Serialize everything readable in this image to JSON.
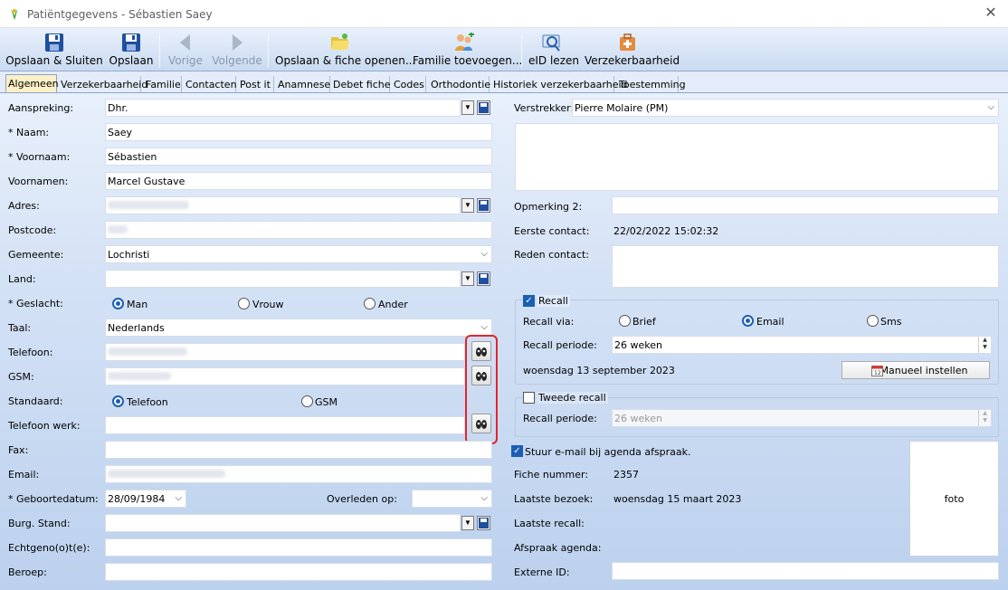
{
  "window": {
    "title": "Patiëntgegevens - Sébastien Saey"
  },
  "toolbar": {
    "save_close": "Opslaan & Sluiten",
    "save": "Opslaan",
    "previous": "Vorige",
    "next": "Volgende",
    "save_open_file": "Opslaan & fiche openen...",
    "add_family": "Familie toevoegen...",
    "read_eid": "eID lezen",
    "insurability": "Verzekerbaarheid"
  },
  "tabs": [
    "Algemeen",
    "Verzekerbaarheid",
    "Familie",
    "Contacten",
    "Post it",
    "Anamnese",
    "Debet fiche",
    "Codes",
    "Orthodontie",
    "Historiek verzekerbaarheid",
    "Toestemming"
  ],
  "left": {
    "aanspreking_label": "Aanspreking:",
    "aanspreking": "Dhr.",
    "naam_label": "* Naam:",
    "naam": "Saey",
    "voornaam_label": "* Voornaam:",
    "voornaam": "Sébastien",
    "voornamen_label": "Voornamen:",
    "voornamen": "Marcel Gustave",
    "adres_label": "Adres:",
    "postcode_label": "Postcode:",
    "gemeente_label": "Gemeente:",
    "gemeente": "Lochristi",
    "land_label": "Land:",
    "geslacht_label": "* Geslacht:",
    "man": "Man",
    "vrouw": "Vrouw",
    "ander": "Ander",
    "taal_label": "Taal:",
    "taal": "Nederlands",
    "telefoon_label": "Telefoon:",
    "gsm_label": "GSM:",
    "standaard_label": "Standaard:",
    "std_telefoon": "Telefoon",
    "std_gsm": "GSM",
    "telefoon_werk_label": "Telefoon werk:",
    "fax_label": "Fax:",
    "email_label": "Email:",
    "geboortedatum_label": "* Geboortedatum:",
    "geboortedatum": "28/09/1984",
    "overleden_label": "Overleden op:",
    "burg_label": "Burg. Stand:",
    "echtgenoot_label": "Echtgeno(o)t(e):",
    "beroep_label": "Beroep:"
  },
  "right": {
    "verstrekker_label": "Verstrekker:",
    "verstrekker": "Pierre Molaire (PM)",
    "opmerking2_label": "Opmerking 2:",
    "eerste_contact_label": "Eerste contact:",
    "eerste_contact": "22/02/2022 15:02:32",
    "reden_label": "Reden contact:",
    "recall_label": "Recall",
    "recall_via_label": "Recall via:",
    "brief": "Brief",
    "email": "Email",
    "sms": "Sms",
    "recall_periode_label": "Recall periode:",
    "recall_periode": "26 weken",
    "recall_date": "woensdag 13 september 2023",
    "manual_button": "Manueel instellen",
    "tweede_recall_label": "Tweede recall",
    "recall_periode2_label": "Recall periode:",
    "recall_periode2": "26 weken",
    "stuur_email": "Stuur e-mail bij agenda afspraak.",
    "fiche_nummer_label": "Fiche nummer:",
    "fiche_nummer": "2357",
    "laatste_bezoek_label": "Laatste bezoek:",
    "laatste_bezoek": "woensdag 15 maart 2023",
    "laatste_recall_label": "Laatste recall:",
    "afspraak_label": "Afspraak agenda:",
    "externe_label": "Externe ID:",
    "foto": "foto"
  }
}
